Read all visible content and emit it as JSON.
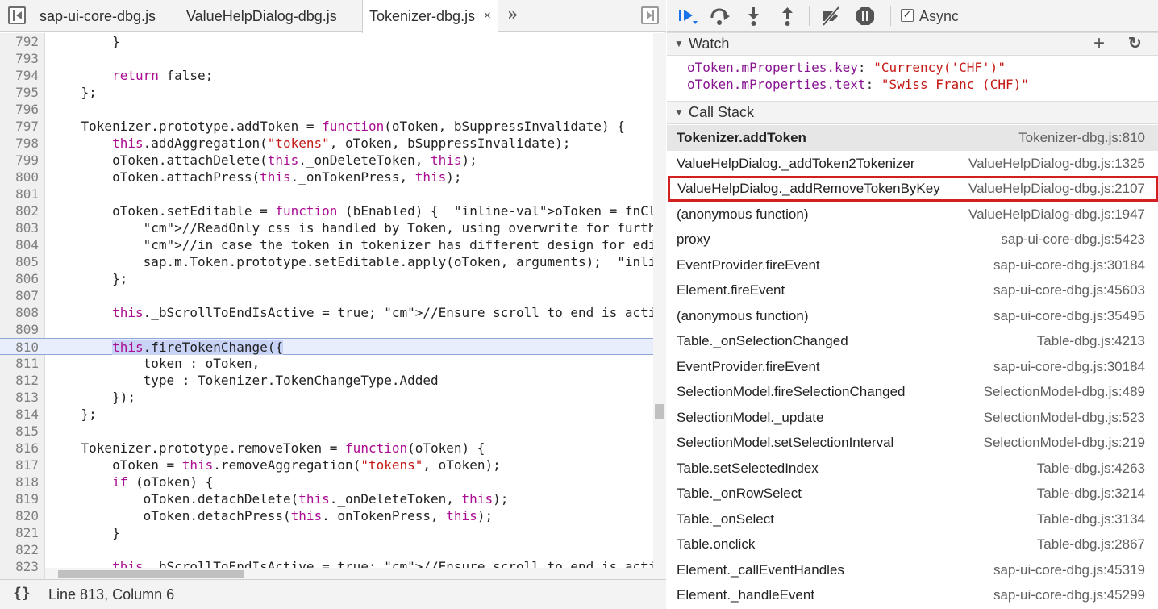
{
  "editor": {
    "tabs": [
      {
        "label": "sap-ui-core-dbg.js"
      },
      {
        "label": "ValueHelpDialog-dbg.js"
      },
      {
        "label": "Tokenizer-dbg.js",
        "close": "×"
      }
    ],
    "more_tabs": "»",
    "status": {
      "format_icon": "{}",
      "cursor_position": "Line 813, Column 6"
    }
  },
  "toolbar": {
    "async_label": "Async",
    "async_checked": "✓"
  },
  "watch": {
    "title": "Watch",
    "add": "+",
    "refresh": "↻",
    "expressions": [
      {
        "key": "oToken.mProperties.key",
        "value": "\"Currency('CHF')\""
      },
      {
        "key": "oToken.mProperties.text",
        "value": "\"Swiss Franc (CHF)\""
      }
    ]
  },
  "call_stack": {
    "title": "Call Stack",
    "frames": [
      {
        "fn": "Tokenizer.addToken",
        "loc": "Tokenizer-dbg.js:810"
      },
      {
        "fn": "ValueHelpDialog._addToken2Tokenizer",
        "loc": "ValueHelpDialog-dbg.js:1325"
      },
      {
        "fn": "ValueHelpDialog._addRemoveTokenByKey",
        "loc": "ValueHelpDialog-dbg.js:2107"
      },
      {
        "fn": "(anonymous function)",
        "loc": "ValueHelpDialog-dbg.js:1947"
      },
      {
        "fn": "proxy",
        "loc": "sap-ui-core-dbg.js:5423"
      },
      {
        "fn": "EventProvider.fireEvent",
        "loc": "sap-ui-core-dbg.js:30184"
      },
      {
        "fn": "Element.fireEvent",
        "loc": "sap-ui-core-dbg.js:45603"
      },
      {
        "fn": "(anonymous function)",
        "loc": "sap-ui-core-dbg.js:35495"
      },
      {
        "fn": "Table._onSelectionChanged",
        "loc": "Table-dbg.js:4213"
      },
      {
        "fn": "EventProvider.fireEvent",
        "loc": "sap-ui-core-dbg.js:30184"
      },
      {
        "fn": "SelectionModel.fireSelectionChanged",
        "loc": "SelectionModel-dbg.js:489"
      },
      {
        "fn": "SelectionModel._update",
        "loc": "SelectionModel-dbg.js:523"
      },
      {
        "fn": "SelectionModel.setSelectionInterval",
        "loc": "SelectionModel-dbg.js:219"
      },
      {
        "fn": "Table.setSelectedIndex",
        "loc": "Table-dbg.js:4263"
      },
      {
        "fn": "Table._onRowSelect",
        "loc": "Table-dbg.js:3214"
      },
      {
        "fn": "Table._onSelect",
        "loc": "Table-dbg.js:3134"
      },
      {
        "fn": "Table.onclick",
        "loc": "Table-dbg.js:2867"
      },
      {
        "fn": "Element._callEventHandles",
        "loc": "sap-ui-core-dbg.js:45319"
      },
      {
        "fn": "Element._handleEvent",
        "loc": "sap-ui-core-dbg.js:45299"
      }
    ]
  },
  "code": {
    "lines": [
      {
        "n": "792",
        "t": "        }"
      },
      {
        "n": "793",
        "t": ""
      },
      {
        "n": "794",
        "t": "        return false;"
      },
      {
        "n": "795",
        "t": "    };"
      },
      {
        "n": "796",
        "t": ""
      },
      {
        "n": "797",
        "t": "    Tokenizer.prototype.addToken = function(oToken, bSuppressInvalidate) {"
      },
      {
        "n": "798",
        "t": "        this.addAggregation(\"tokens\", oToken, bSuppressInvalidate);"
      },
      {
        "n": "799",
        "t": "        oToken.attachDelete(this._onDeleteToken, this);"
      },
      {
        "n": "800",
        "t": "        oToken.attachPress(this._onTokenPress, this);"
      },
      {
        "n": "801",
        "t": ""
      },
      {
        "n": "802",
        "t": "        oToken.setEditable = function (bEnabled) {  oToken = fnClass {bAllow"
      },
      {
        "n": "803",
        "t": "            //ReadOnly css is handled by Token, using overwrite for further"
      },
      {
        "n": "804",
        "t": "            //in case the token in tokenizer has different design for editab"
      },
      {
        "n": "805",
        "t": "            sap.m.Token.prototype.setEditable.apply(oToken, arguments);  oTo"
      },
      {
        "n": "806",
        "t": "        };"
      },
      {
        "n": "807",
        "t": ""
      },
      {
        "n": "808",
        "t": "        this._bScrollToEndIsActive = true; //Ensure scroll to end is active"
      },
      {
        "n": "809",
        "t": ""
      },
      {
        "n": "810",
        "t": "        this.fireTokenChange({"
      },
      {
        "n": "811",
        "t": "            token : oToken,"
      },
      {
        "n": "812",
        "t": "            type : Tokenizer.TokenChangeType.Added"
      },
      {
        "n": "813",
        "t": "        });"
      },
      {
        "n": "814",
        "t": "    };"
      },
      {
        "n": "815",
        "t": ""
      },
      {
        "n": "816",
        "t": "    Tokenizer.prototype.removeToken = function(oToken) {"
      },
      {
        "n": "817",
        "t": "        oToken = this.removeAggregation(\"tokens\", oToken);"
      },
      {
        "n": "818",
        "t": "        if (oToken) {"
      },
      {
        "n": "819",
        "t": "            oToken.detachDelete(this._onDeleteToken, this);"
      },
      {
        "n": "820",
        "t": "            oToken.detachPress(this._onTokenPress, this);"
      },
      {
        "n": "821",
        "t": "        }"
      },
      {
        "n": "822",
        "t": ""
      },
      {
        "n": "823",
        "t": "        this._bScrollToEndIsActive = true; //Ensure scroll to end is active"
      }
    ],
    "current_line": "810"
  },
  "colors": {
    "keyword": "#aa0d91",
    "string": "#c41a16",
    "comment": "#237c23",
    "resume_blue": "#1a73e8",
    "highlight_red": "#d22020"
  },
  "icons": {
    "resume": "resume-icon",
    "step_over": "step-over-icon",
    "step_into": "step-into-icon",
    "step_out": "step-out-icon",
    "deactivate": "deactivate-breakpoints-icon",
    "pause_exceptions": "pause-on-exceptions-icon"
  }
}
